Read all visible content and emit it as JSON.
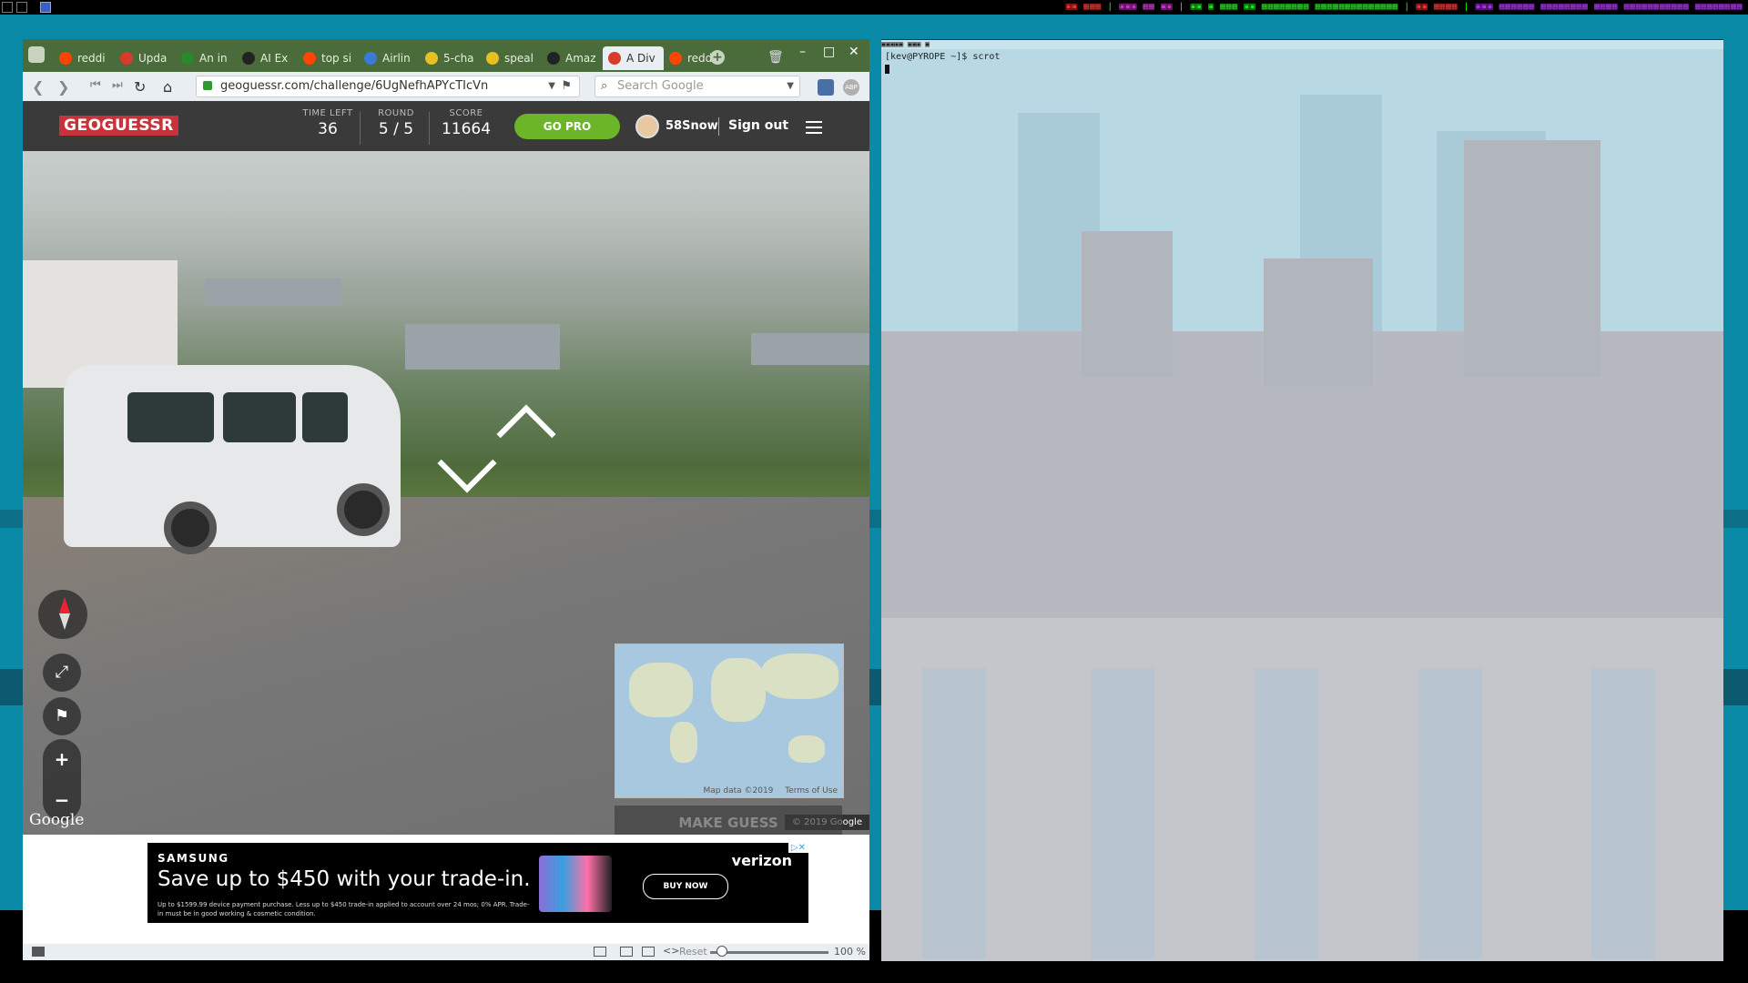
{
  "panel": {
    "workspaces": [
      "1",
      "2",
      "3"
    ],
    "status_segments": [
      {
        "text": "▣▣ ▦▦▦",
        "color": "red"
      },
      {
        "text": "▣▣▣ ▦▦ ▣▣",
        "color": "magenta"
      },
      {
        "text": "▣▣ ▣ ▦▦▦ ▣▣ ▦▦▦▦▦▦▦▦ ▦▦▦▦▦▦▦▦▦▦▦▦▦▦",
        "color": "green"
      },
      {
        "text": "▣▣ ▦▦▦▦",
        "color": "red"
      },
      {
        "text": "▣▣▣ ▦▦▦▦▦▦ ▦▦▦▦▦▦▦▦ ▦▦▦▦ ▦▦▦▦▦▦▦▦▦▦▦ ▦▦▦▦▦▦▦▦",
        "color": "purple"
      }
    ]
  },
  "browser": {
    "tabs": [
      {
        "label": "reddi",
        "fav": "#ff4500"
      },
      {
        "label": "Upda",
        "fav": "#d63b2b"
      },
      {
        "label": "An in",
        "fav": "#2a8a2a"
      },
      {
        "label": "AI Ex",
        "fav": "#222222"
      },
      {
        "label": "top si",
        "fav": "#ff4500"
      },
      {
        "label": "Airlin",
        "fav": "#3a7bd5"
      },
      {
        "label": "5-cha",
        "fav": "#e8c020"
      },
      {
        "label": "speal",
        "fav": "#e8c020"
      },
      {
        "label": "Amaz",
        "fav": "#222222"
      },
      {
        "label": "A Div",
        "fav": "#d63b2b"
      },
      {
        "label": "reddi",
        "fav": "#ff4500"
      }
    ],
    "active_tab_index": 9,
    "url": "geoguessr.com/challenge/6UgNefhAPYcTIcVn",
    "search_placeholder": "Search Google",
    "ext_abp": "ABP"
  },
  "geoguessr": {
    "logo": "GEOGUESSR",
    "time_left_label": "TIME LEFT",
    "time_left": "36",
    "round_label": "ROUND",
    "round": "5 / 5",
    "score_label": "SCORE",
    "score": "11664",
    "go_pro": "GO PRO",
    "username": "58Snow",
    "sign_out": "Sign out",
    "make_guess": "MAKE GUESS",
    "map_data": "Map data ©2019",
    "terms": "Terms of Use",
    "google_logo": "Google",
    "copyright": "© 2019 Google"
  },
  "ad": {
    "brand": "SAMSUNG",
    "headline": "Save up to $450 with your trade-in.",
    "fine_print": "Up to $1599.99 device payment purchase. Less up to $450 trade-in applied to account over 24 mos; 0% APR. Trade-in must be in good working & cosmetic condition.",
    "cta": "BUY NOW",
    "carrier": "verizon",
    "adchoices": "▷✕"
  },
  "statusbar": {
    "reset": "Reset",
    "zoom": "100 %",
    "zoom_fraction": 0.1
  },
  "terminal": {
    "title_glyphs": "▣▣▣▣▣ ▣▣▣ ▣",
    "prompt": "[kev@PYROPE ~]$ scrot"
  }
}
